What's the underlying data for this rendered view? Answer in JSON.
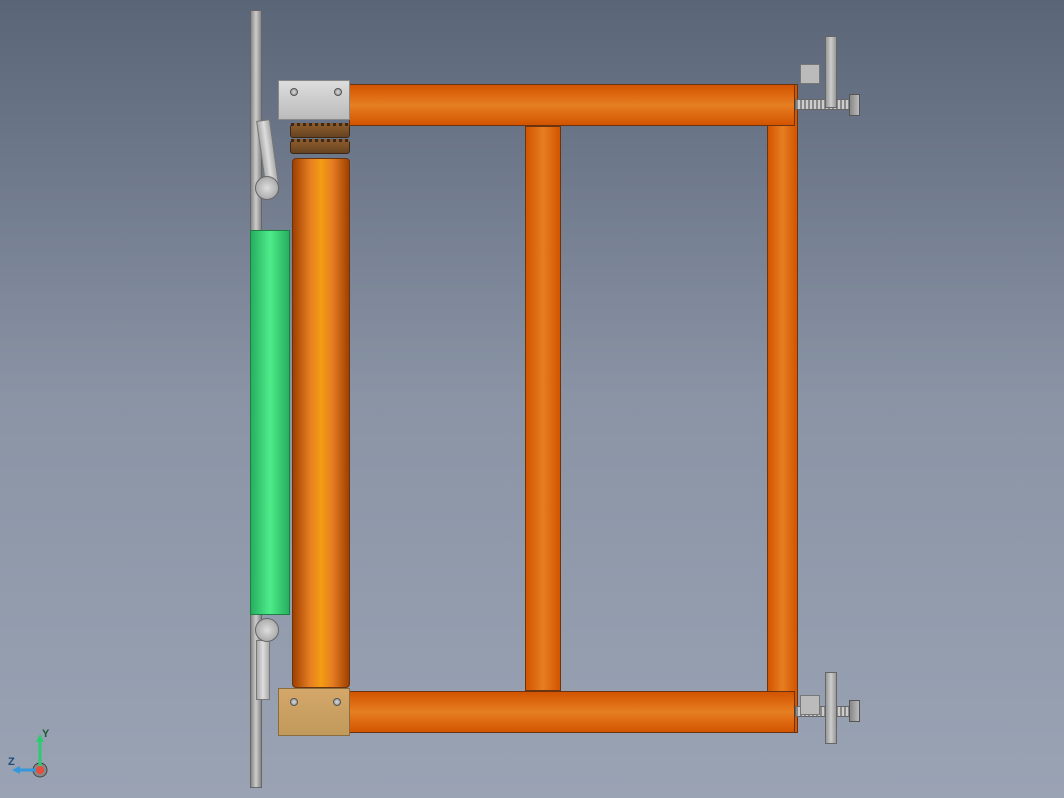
{
  "view": {
    "type": "cad_orthographic",
    "orientation": "front"
  },
  "axes": {
    "y_label": "Y",
    "z_label": "Z",
    "y_color": "#2ecc71",
    "z_color": "#3498db",
    "x_color": "#e74c3c"
  },
  "components": {
    "frame": {
      "color": "#e67e22",
      "material": "steel-tube"
    },
    "roller": {
      "color": "#e67e22",
      "type": "cylinder"
    },
    "panel": {
      "color": "#2ecc71",
      "type": "plate"
    },
    "rod": {
      "color": "#bbbbbb",
      "type": "shaft"
    }
  }
}
